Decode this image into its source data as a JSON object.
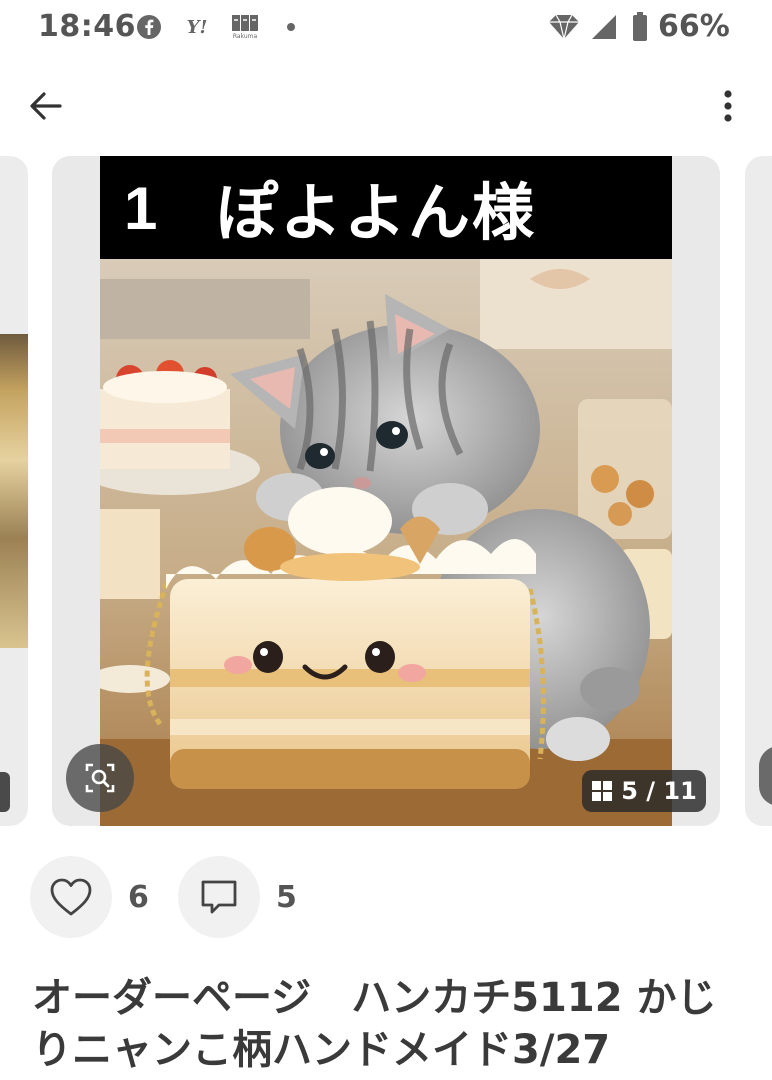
{
  "status_bar": {
    "time": "18:46",
    "battery_percent": "66%",
    "yahoo_glyph": "Y!",
    "rakuma_label": "Rakuma",
    "icons": [
      "facebook-icon",
      "yahoo-icon",
      "rakuma-icon",
      "dot-icon",
      "diamond-icon",
      "signal-icon",
      "battery-icon"
    ]
  },
  "app_bar": {
    "back_icon": "arrow-left-icon",
    "more_icon": "more-vertical-icon"
  },
  "gallery": {
    "banner_number": "1",
    "banner_text": "ぽよよん様",
    "counter": "5 / 11",
    "current_index": 5,
    "total": 11,
    "lens_icon": "image-search-icon",
    "counter_icon": "grid-icon"
  },
  "reactions": {
    "likes": "6",
    "comments": "5",
    "like_icon": "heart-icon",
    "comment_icon": "comment-icon"
  },
  "item": {
    "title": "オーダーページ　ハンカチ5112 かじりニャンこ柄ハンドメイド3/27"
  },
  "colors": {
    "background": "#ffffff",
    "card_background": "#e9e9e9",
    "text": "#3a3a3a",
    "badge_background": "#282828"
  }
}
